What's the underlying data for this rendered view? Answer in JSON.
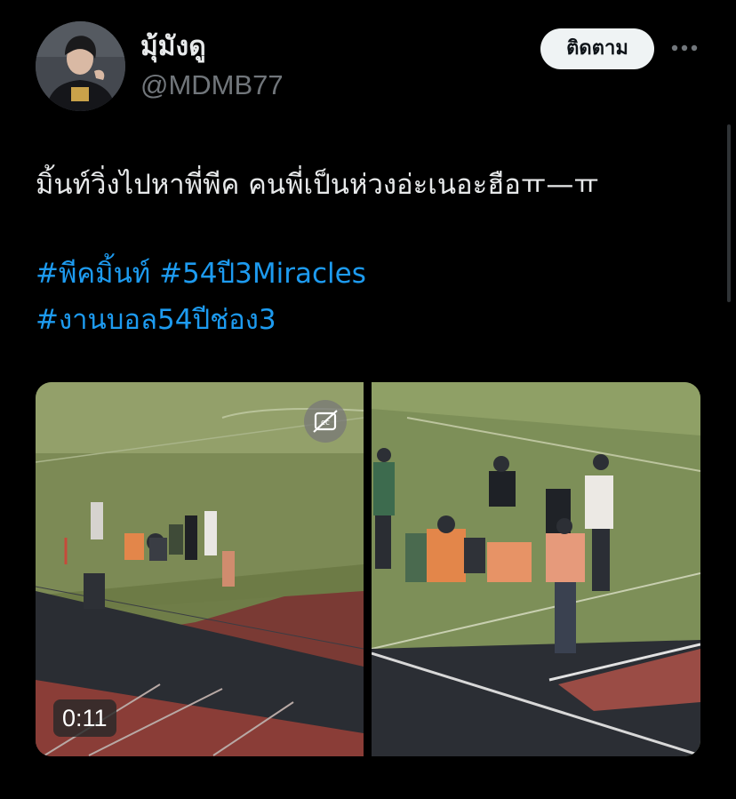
{
  "user": {
    "display_name": "มุ้มังดู",
    "handle": "@MDMB77"
  },
  "actions": {
    "follow_label": "ติดตาม",
    "more_icon": "more-horizontal-icon"
  },
  "tweet": {
    "text_line1": "มิ้นท์วิ่งไปหาพี่พีค คนพี่เป็นห่วงอ่ะเนอะฮือ",
    "text_emoticon": "ㅠ—ㅠ",
    "hashtags_line1": [
      "#พีคมิ้นท์",
      "#54ปี3Miracles"
    ],
    "hashtags_line2": [
      "#งานบอล54ปีช่อง3"
    ]
  },
  "media": {
    "video_duration": "0:11",
    "captions_icon": "closed-captions-off-icon"
  },
  "colors": {
    "background": "#000000",
    "text": "#e7e9ea",
    "secondary_text": "#71767b",
    "hashtag": "#1d9bf0",
    "follow_button_bg": "#eff3f4"
  }
}
